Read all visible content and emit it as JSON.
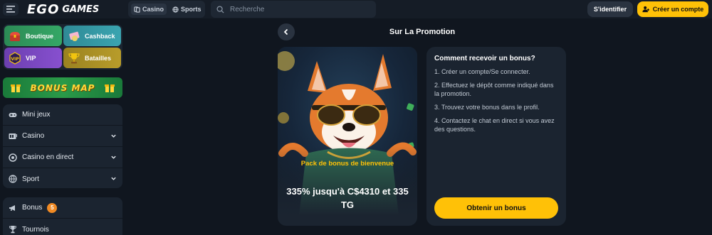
{
  "header": {
    "logo_main": "EGO",
    "logo_sub": "GAMES",
    "nav_tabs": [
      {
        "label": "Casino",
        "icon": "cards-icon"
      },
      {
        "label": "Sports",
        "icon": "ball-icon"
      }
    ],
    "search_placeholder": "Recherche",
    "login_label": "S'identifier",
    "register_label": "Créer un compte"
  },
  "sidebar": {
    "quick_links": [
      {
        "label": "Boutique",
        "icon": "chest-icon"
      },
      {
        "label": "Cashback",
        "icon": "cashback-icon"
      },
      {
        "label": "VIP",
        "icon": "vip-icon"
      },
      {
        "label": "Batailles",
        "icon": "trophy-icon"
      }
    ],
    "bonus_map_label": "BONUS MAP",
    "menu_primary": [
      {
        "label": "Mini jeux",
        "icon": "gamepad-icon",
        "expandable": false
      },
      {
        "label": "Casino",
        "icon": "slot-icon",
        "expandable": true
      },
      {
        "label": "Casino en direct",
        "icon": "chip-icon",
        "expandable": true
      },
      {
        "label": "Sport",
        "icon": "ball-icon",
        "expandable": true
      }
    ],
    "menu_secondary": [
      {
        "label": "Bonus",
        "icon": "megaphone-icon",
        "badge": "5"
      },
      {
        "label": "Tournois",
        "icon": "trophy-icon"
      }
    ]
  },
  "main": {
    "title": "Sur La Promotion",
    "promo": {
      "subtitle": "Pack de bonus de bienvenue",
      "value": "335% jusqu'à C$4310 et 335 TG"
    },
    "info": {
      "title": "Comment recevoir un bonus?",
      "steps": [
        "1. Créer un compte/Se connecter.",
        "2. Effectuez le dépôt comme indiqué dans la promotion.",
        "3. Trouvez votre bonus dans le profil.",
        "4. Contactez le chat en direct si vous avez des questions."
      ],
      "button_label": "Obtenir un bonus"
    }
  },
  "colors": {
    "accent": "#ffc107",
    "background": "#10161f",
    "panel": "#1b2430",
    "badge": "#f08a24"
  }
}
